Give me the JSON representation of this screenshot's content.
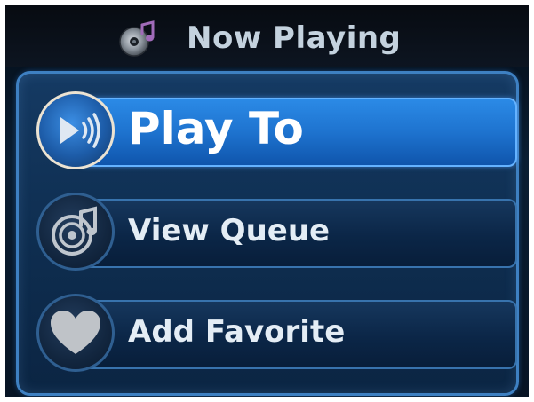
{
  "header": {
    "title": "Now Playing",
    "icon": "music-cd-icon"
  },
  "menu": {
    "items": [
      {
        "label": "Play To",
        "icon": "speaker-sound-icon",
        "selected": true
      },
      {
        "label": "View Queue",
        "icon": "music-queue-icon",
        "selected": false
      },
      {
        "label": "Add Favorite",
        "icon": "heart-icon",
        "selected": false
      }
    ]
  },
  "colors": {
    "background": "#0a1e33",
    "accent": "#1e73cf",
    "panel_border": "#3e80c2",
    "text": "#e4edf5"
  }
}
